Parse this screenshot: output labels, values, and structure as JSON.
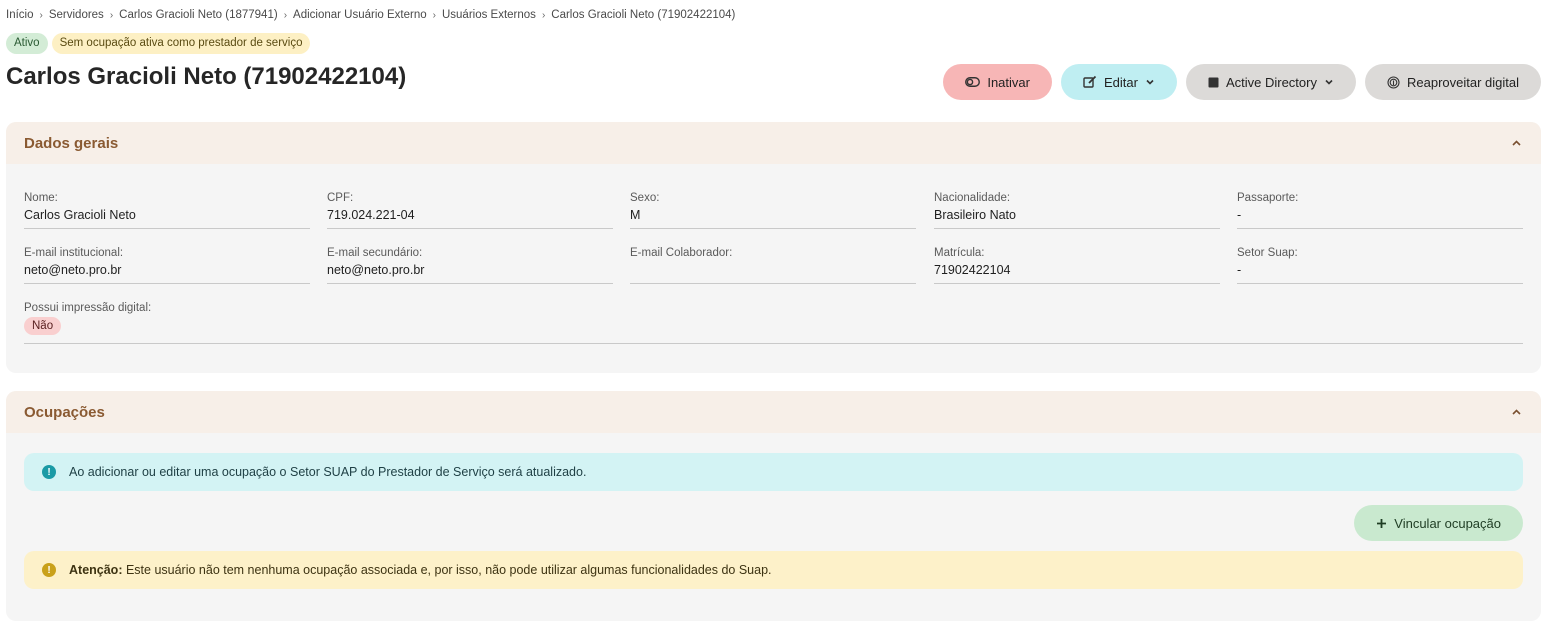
{
  "breadcrumb": [
    "Início",
    "Servidores",
    "Carlos Gracioli Neto (1877941)",
    "Adicionar Usuário Externo",
    "Usuários Externos",
    "Carlos Gracioli Neto (71902422104)"
  ],
  "badges": {
    "status": "Ativo",
    "occupation": "Sem ocupação ativa como prestador de serviço"
  },
  "title": "Carlos Gracioli Neto (71902422104)",
  "actions": {
    "inactivate": "Inativar",
    "edit": "Editar",
    "active_directory": "Active Directory",
    "reuse_fingerprint": "Reaproveitar digital"
  },
  "general": {
    "title": "Dados gerais",
    "fields": {
      "nome": {
        "label": "Nome:",
        "value": "Carlos Gracioli Neto"
      },
      "cpf": {
        "label": "CPF:",
        "value": "719.024.221-04"
      },
      "sexo": {
        "label": "Sexo:",
        "value": "M"
      },
      "nacionalidade": {
        "label": "Nacionalidade:",
        "value": "Brasileiro Nato"
      },
      "passaporte": {
        "label": "Passaporte:",
        "value": "-"
      },
      "email_inst": {
        "label": "E-mail institucional:",
        "value": "neto@neto.pro.br"
      },
      "email_sec": {
        "label": "E-mail secundário:",
        "value": "neto@neto.pro.br"
      },
      "email_colab": {
        "label": "E-mail Colaborador:",
        "value": ""
      },
      "matricula": {
        "label": "Matrícula:",
        "value": "71902422104"
      },
      "setor": {
        "label": "Setor Suap:",
        "value": "-"
      },
      "digital": {
        "label": "Possui impressão digital:",
        "value": "Não"
      }
    }
  },
  "occupations": {
    "title": "Ocupações",
    "info": "Ao adicionar ou editar uma ocupação o Setor SUAP do Prestador de Serviço será atualizado.",
    "add_button": "Vincular ocupação",
    "warning_strong": "Atenção:",
    "warning_text": " Este usuário não tem nenhuma ocupação associada e, por isso, não pode utilizar algumas funcionalidades do Suap."
  },
  "colors": {
    "accent": "#8a5a32",
    "danger": "#f7b6b6",
    "info": "#bfeef2",
    "success": "#c9e9cf",
    "warning": "#fdf1c9"
  },
  "icons": {
    "inactivate": "toggle-icon",
    "edit": "edit-icon",
    "active_directory": "square-icon",
    "reuse": "fingerprint-icon",
    "add": "plus-icon",
    "info": "info-icon",
    "warn": "warning-icon"
  }
}
